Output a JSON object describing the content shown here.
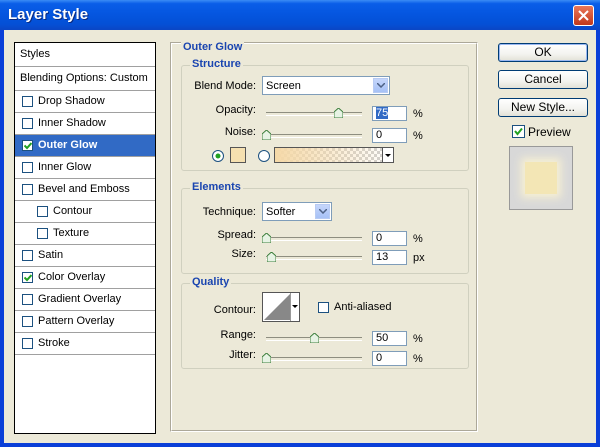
{
  "window": {
    "title": "Layer Style"
  },
  "styles_list": {
    "header": "Styles",
    "blending": "Blending Options: Custom",
    "items": [
      {
        "label": "Drop Shadow",
        "checked": false,
        "selected": false,
        "indent": false
      },
      {
        "label": "Inner Shadow",
        "checked": false,
        "selected": false,
        "indent": false
      },
      {
        "label": "Outer Glow",
        "checked": true,
        "selected": true,
        "indent": false
      },
      {
        "label": "Inner Glow",
        "checked": false,
        "selected": false,
        "indent": false
      },
      {
        "label": "Bevel and Emboss",
        "checked": false,
        "selected": false,
        "indent": false
      },
      {
        "label": "Contour",
        "checked": false,
        "selected": false,
        "indent": true
      },
      {
        "label": "Texture",
        "checked": false,
        "selected": false,
        "indent": true
      },
      {
        "label": "Satin",
        "checked": false,
        "selected": false,
        "indent": false
      },
      {
        "label": "Color Overlay",
        "checked": true,
        "selected": false,
        "indent": false
      },
      {
        "label": "Gradient Overlay",
        "checked": false,
        "selected": false,
        "indent": false
      },
      {
        "label": "Pattern Overlay",
        "checked": false,
        "selected": false,
        "indent": false
      },
      {
        "label": "Stroke",
        "checked": false,
        "selected": false,
        "indent": false
      }
    ]
  },
  "panel": {
    "title": "Outer Glow",
    "structure": {
      "title": "Structure",
      "blend_mode_label": "Blend Mode:",
      "blend_mode": "Screen",
      "opacity_label": "Opacity:",
      "opacity": "75",
      "opacity_fraction": 0.75,
      "opacity_unit": "%",
      "noise_label": "Noise:",
      "noise": "0",
      "noise_fraction": 0,
      "noise_unit": "%",
      "glow_color": "#f5e0b0"
    },
    "elements": {
      "title": "Elements",
      "technique_label": "Technique:",
      "technique": "Softer",
      "spread_label": "Spread:",
      "spread": "0",
      "spread_fraction": 0,
      "spread_unit": "%",
      "size_label": "Size:",
      "size": "13",
      "size_fraction": 0.05,
      "size_unit": "px"
    },
    "quality": {
      "title": "Quality",
      "contour_label": "Contour:",
      "antialiased_label": "Anti-aliased",
      "range_label": "Range:",
      "range": "50",
      "range_fraction": 0.5,
      "range_unit": "%",
      "jitter_label": "Jitter:",
      "jitter": "0",
      "jitter_fraction": 0,
      "jitter_unit": "%"
    }
  },
  "buttons": {
    "ok": "OK",
    "cancel": "Cancel",
    "new_style": "New Style...",
    "preview_label": "Preview"
  },
  "colors": {
    "selection": "#316ac5",
    "group_title": "#1a45b0",
    "preview_swatch": "#f3e6b5"
  }
}
